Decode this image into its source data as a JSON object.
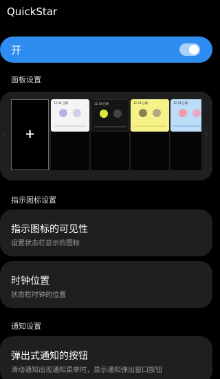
{
  "app": {
    "title": "QuickStar"
  },
  "master": {
    "label": "开",
    "enabled": true,
    "accent": "#2f8df2"
  },
  "sections": {
    "panel": "面板设置",
    "indicator": "指示图标设置",
    "notification": "通知设置"
  },
  "panel": {
    "add_symbol": "+",
    "prev_arrow": "‹",
    "next_arrow": "›",
    "themes": [
      {
        "name": "white-theme",
        "time": "12:34  日期",
        "bg": "#f4f4f6",
        "fg": "#333333",
        "c1": "#b9b1e6",
        "c2": "#d3d0e8",
        "bar": "#dddddd"
      },
      {
        "name": "black-theme",
        "time": "12:34  日期",
        "bg": "#151515",
        "fg": "#dddddd",
        "c1": "#e0e83c",
        "c2": "#444444",
        "bar": "#333333"
      },
      {
        "name": "yellow-theme",
        "time": "12:34  日期",
        "bg": "#f6f28a",
        "fg": "#333333",
        "c1": "#8a8350",
        "c2": "#b0aa88",
        "bar": "#e4dc6c"
      },
      {
        "name": "blue-theme",
        "time": "12:34  日期",
        "bg": "#bcdcf8",
        "fg": "#333333",
        "c1": "#f19aa6",
        "c2": "#e7a9c7",
        "bar": "#9cc6ee"
      }
    ]
  },
  "settings": {
    "visibility": {
      "title": "指示图标的可见性",
      "subtitle": "设置状态栏显示的图标"
    },
    "clock": {
      "title": "时钟位置",
      "subtitle": "状态栏时钟的位置"
    },
    "popup": {
      "title": "弹出式通知的按钮",
      "subtitle": "滑动通知出现通知菜单时，显示通知弹出窗口按钮"
    }
  }
}
